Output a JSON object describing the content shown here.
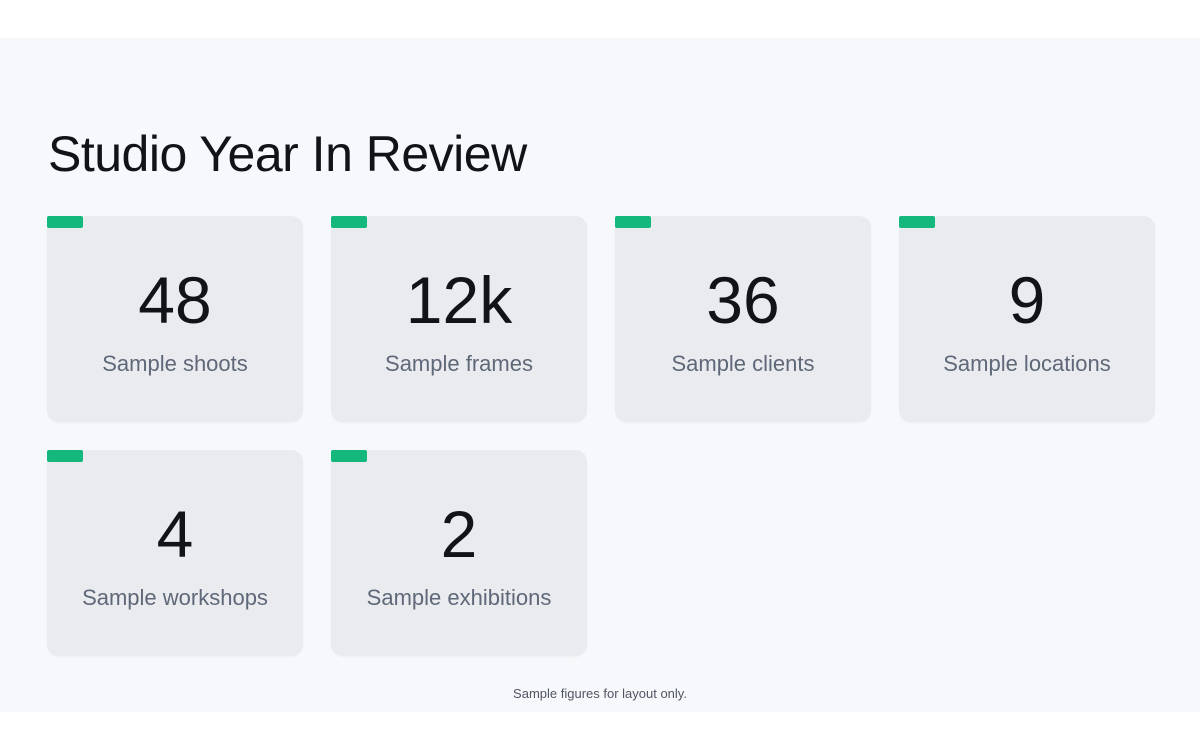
{
  "page": {
    "title": "Studio Year In Review",
    "footer": "Sample figures for layout only."
  },
  "stats": [
    {
      "value": "48",
      "label": "Sample shoots"
    },
    {
      "value": "12k",
      "label": "Sample frames"
    },
    {
      "value": "36",
      "label": "Sample clients"
    },
    {
      "value": "9",
      "label": "Sample locations"
    },
    {
      "value": "4",
      "label": "Sample workshops"
    },
    {
      "value": "2",
      "label": "Sample exhibitions"
    }
  ],
  "colors": {
    "accent": "#14b87d",
    "card_background": "#e9ebef",
    "panel_background": "#f6f8fb",
    "value_text": "#111318",
    "label_text": "#5f6878"
  }
}
